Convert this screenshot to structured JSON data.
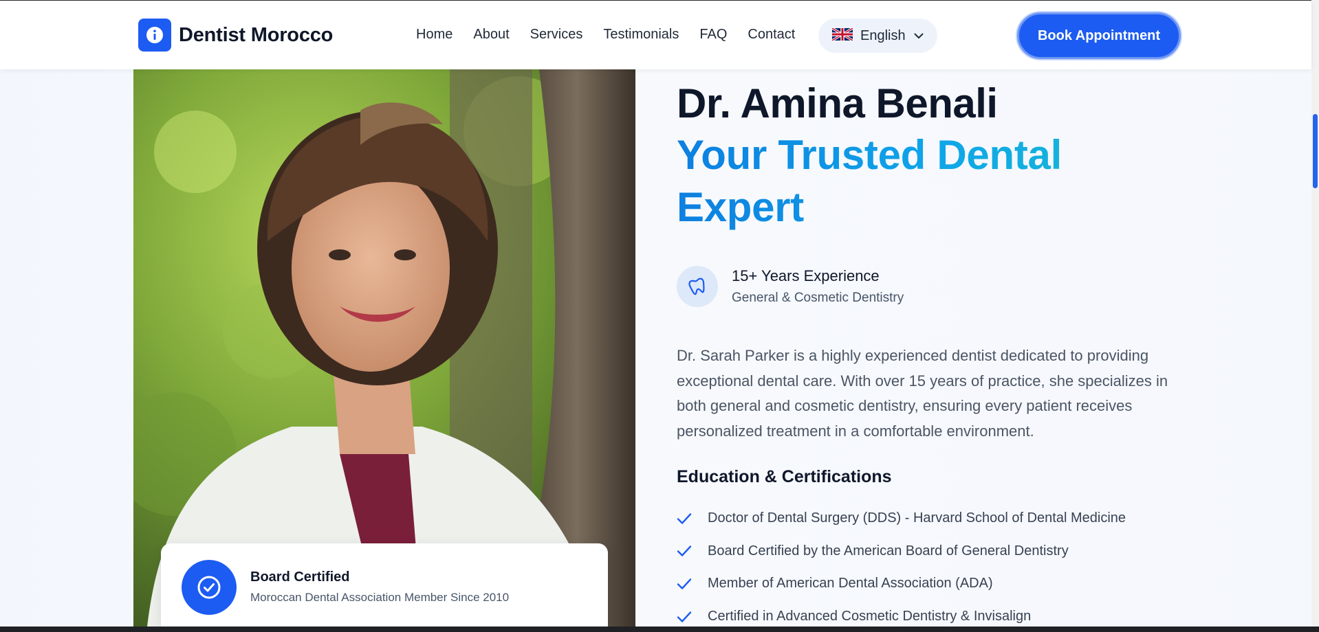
{
  "brand": {
    "name": "Dentist Morocco",
    "logo_icon": "info-icon",
    "accent": "#1d5cf2"
  },
  "nav": {
    "items": [
      {
        "label": "Home"
      },
      {
        "label": "About"
      },
      {
        "label": "Services"
      },
      {
        "label": "Testimonials"
      },
      {
        "label": "FAQ"
      },
      {
        "label": "Contact"
      }
    ]
  },
  "language": {
    "label": "English",
    "flag_icon": "uk-flag-icon"
  },
  "cta": {
    "label": "Book Appointment"
  },
  "hero": {
    "name": "Dr. Amina Benali",
    "tagline": "Your Trusted Dental Expert",
    "experience_title": "15+ Years Experience",
    "experience_sub": "General & Cosmetic Dentistry",
    "bio": "Dr. Sarah Parker is a highly experienced dentist dedicated to providing exceptional dental care. With over 15 years of practice, she specializes in both general and cosmetic dentistry, ensuring every patient receives personalized treatment in a comfortable environment."
  },
  "certificate_card": {
    "title": "Board Certified",
    "subtitle": "Moroccan Dental Association Member Since 2010"
  },
  "education": {
    "title": "Education & Certifications",
    "items": [
      "Doctor of Dental Surgery (DDS) - Harvard School of Dental Medicine",
      "Board Certified by the American Board of General Dentistry",
      "Member of American Dental Association (ADA)",
      "Certified in Advanced Cosmetic Dentistry & Invisalign"
    ]
  }
}
